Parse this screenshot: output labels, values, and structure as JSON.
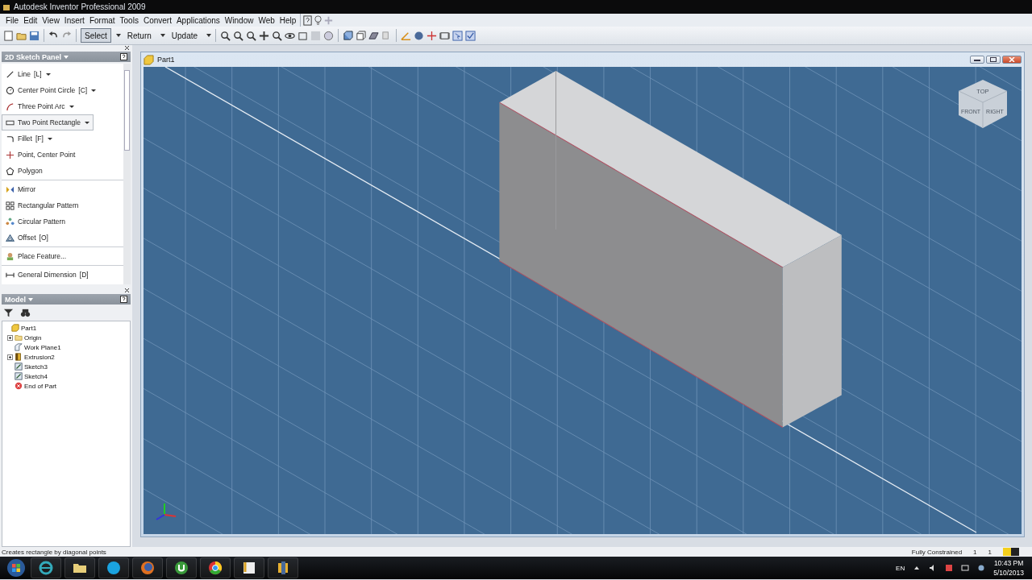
{
  "window": {
    "title": "Autodesk Inventor Professional 2009"
  },
  "menu": [
    "File",
    "Edit",
    "View",
    "Insert",
    "Format",
    "Tools",
    "Convert",
    "Applications",
    "Window",
    "Web",
    "Help"
  ],
  "toolbar": {
    "buttons": [
      {
        "label": "Select",
        "pressed": true
      },
      {
        "label": "Return",
        "pressed": false
      },
      {
        "label": "Update",
        "pressed": false
      }
    ]
  },
  "sketch_panel": {
    "title": "2D Sketch Panel",
    "groups": [
      [
        {
          "label": "Line",
          "shortcut": "[L]",
          "dropdown": true,
          "selected": false
        },
        {
          "label": "Center Point Circle",
          "shortcut": "[C]",
          "dropdown": true,
          "selected": false
        },
        {
          "label": "Three Point Arc",
          "dropdown": true,
          "selected": false
        },
        {
          "label": "Two Point Rectangle",
          "dropdown": true,
          "selected": true
        },
        {
          "label": "Fillet",
          "shortcut": "[F]",
          "dropdown": true,
          "selected": false
        },
        {
          "label": "Point, Center Point",
          "dropdown": false,
          "selected": false
        },
        {
          "label": "Polygon",
          "dropdown": false,
          "selected": false
        }
      ],
      [
        {
          "label": "Mirror",
          "dropdown": false,
          "selected": false
        },
        {
          "label": "Rectangular Pattern",
          "dropdown": false,
          "selected": false
        },
        {
          "label": "Circular Pattern",
          "dropdown": false,
          "selected": false
        },
        {
          "label": "Offset",
          "shortcut": "[O]",
          "dropdown": false,
          "selected": false
        }
      ],
      [
        {
          "label": "Place Feature...",
          "dropdown": false,
          "selected": false
        }
      ],
      [
        {
          "label": "General Dimension",
          "shortcut": "[D]",
          "dropdown": false,
          "selected": false
        }
      ]
    ]
  },
  "model_panel": {
    "title": "Model",
    "tree": [
      {
        "label": "Part1",
        "kind": "part",
        "children": [
          {
            "label": "Origin",
            "kind": "folder",
            "expanded": false
          },
          {
            "label": "Work Plane1",
            "kind": "plane"
          },
          {
            "label": "Extrusion2",
            "kind": "extrusion",
            "expanded": false
          },
          {
            "label": "Sketch3",
            "kind": "sketch"
          },
          {
            "label": "Sketch4",
            "kind": "sketch"
          },
          {
            "label": "End of Part",
            "kind": "end"
          }
        ]
      }
    ]
  },
  "document": {
    "title": "Part1",
    "view_cube": [
      "TOP",
      "FRONT",
      "RIGHT"
    ]
  },
  "status_bar": {
    "message": "Creates rectangle by diagonal points",
    "state": "Fully Constrained",
    "count_1": "1",
    "count_2": "1"
  },
  "taskbar": {
    "language": "EN",
    "time": "10:43 PM",
    "date": "5/10/2013"
  }
}
